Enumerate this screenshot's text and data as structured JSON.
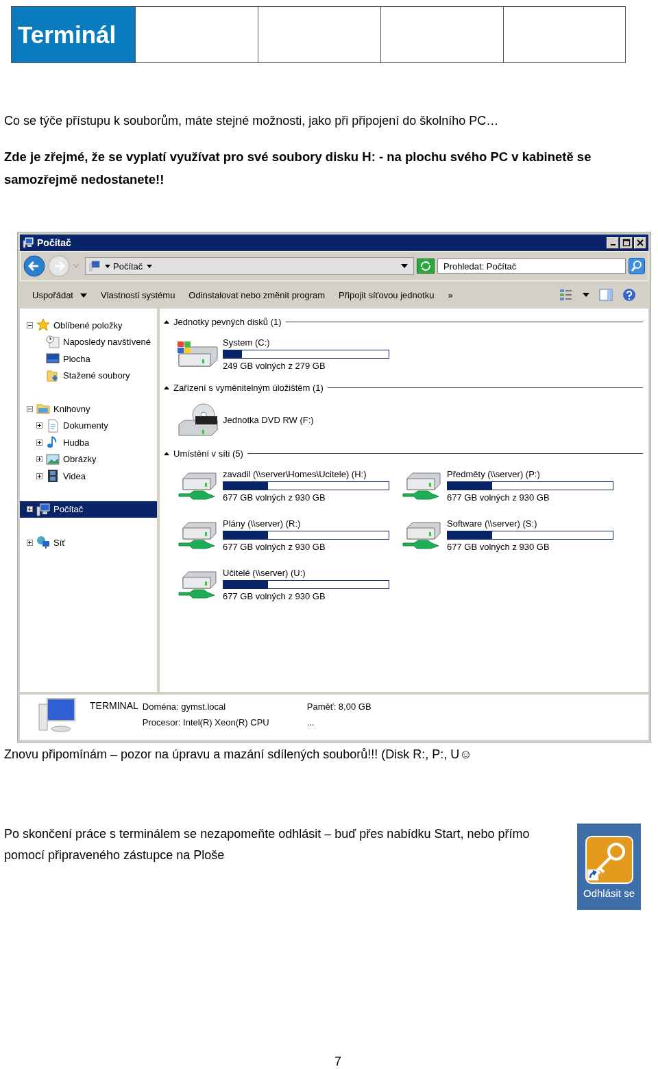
{
  "header": {
    "title": "Terminál"
  },
  "paragraphs": [
    {
      "kind": "plain",
      "text": "Co se týče přístupu k souborům, máte stejné možnosti, jako při připojení do školního PC…"
    },
    {
      "kind": "bold",
      "text": "Zde je zřejmé, že se vyplatí využívat pro své soubory disku H: - na plochu svého PC v kabinetě se samozřejmě nedostanete!!"
    }
  ],
  "explorer": {
    "title": "Počítač",
    "address": "Počítač",
    "search": {
      "placeholder": "Prohledat: Počítač"
    },
    "commands": [
      {
        "kind": "menu",
        "label": "Uspořádat"
      },
      {
        "kind": "command",
        "label": "Vlastnosti systému"
      },
      {
        "kind": "command",
        "label": "Odinstalovat nebo změnit program"
      },
      {
        "kind": "command",
        "label": "Připojit síťovou jednotku"
      },
      {
        "kind": "more",
        "label": "»"
      }
    ],
    "tree": [
      {
        "label": "Oblíbené položky",
        "expanded": true,
        "selected": false,
        "children": [
          {
            "label": "Naposledy navštívené",
            "selected": false
          },
          {
            "label": "Plocha",
            "selected": false
          },
          {
            "label": "Stažené soubory",
            "selected": false
          }
        ]
      },
      {
        "label": "Knihovny",
        "expanded": true,
        "selected": false,
        "children": [
          {
            "label": "Dokumenty",
            "expanded": false,
            "selected": false
          },
          {
            "label": "Hudba",
            "expanded": false,
            "selected": false
          },
          {
            "label": "Obrázky",
            "expanded": false,
            "selected": false
          },
          {
            "label": "Videa",
            "expanded": false,
            "selected": false
          }
        ]
      },
      {
        "label": "Počítač",
        "expanded": false,
        "selected": true
      },
      {
        "label": "Síť",
        "expanded": false,
        "selected": false
      }
    ],
    "groups": [
      {
        "title": "Jednotky pevných disků (1)",
        "items": [
          {
            "kind": "system",
            "name": "System (C:)",
            "level": 0.11,
            "free": "249 GB volných z 279 GB"
          }
        ]
      },
      {
        "title": "Zařízení s vyměnitelným úložištěm (1)",
        "items": [
          {
            "kind": "dvd",
            "name": "Jednotka DVD RW (F:)"
          }
        ]
      },
      {
        "title": "Umístění v síti (5)",
        "items": [
          {
            "kind": "network",
            "name": "zavadil (\\\\server\\Homes\\Ucitele) (H:)",
            "level": 0.27,
            "free": "677 GB volných z 930 GB"
          },
          {
            "kind": "network",
            "name": "Předměty (\\\\server) (P:)",
            "level": 0.27,
            "free": "677 GB volných z 930 GB"
          },
          {
            "kind": "network",
            "name": "Plány (\\\\server) (R:)",
            "level": 0.27,
            "free": "677 GB volných z 930 GB"
          },
          {
            "kind": "network",
            "name": "Software (\\\\server) (S:)",
            "level": 0.27,
            "free": "677 GB volných z 930 GB"
          },
          {
            "kind": "network",
            "name": "Učitelé (\\\\server) (U:)",
            "level": 0.27,
            "free": "677 GB volných z 930 GB"
          }
        ]
      }
    ],
    "details": {
      "name": "TERMINAL",
      "fields": [
        {
          "label": "Doména:",
          "value": "gymst.local"
        },
        {
          "label": "Paměť:",
          "value": "8,00 GB"
        },
        {
          "label": "Procesor:",
          "value": "Intel(R) Xeon(R) CPU"
        }
      ],
      "more": "..."
    }
  },
  "warning": "Znovu připomínám – pozor na úpravu a mazání sdílených souborů!!! (Disk R:, P:, U☺",
  "logout": {
    "text": "Po skončení práce s terminálem se nezapomeňte odhlásit – buď přes nabídku Start, nebo přímo pomocí připraveného zástupce na Ploše",
    "shortcut": "Odhlásit se"
  },
  "page_number": "7"
}
